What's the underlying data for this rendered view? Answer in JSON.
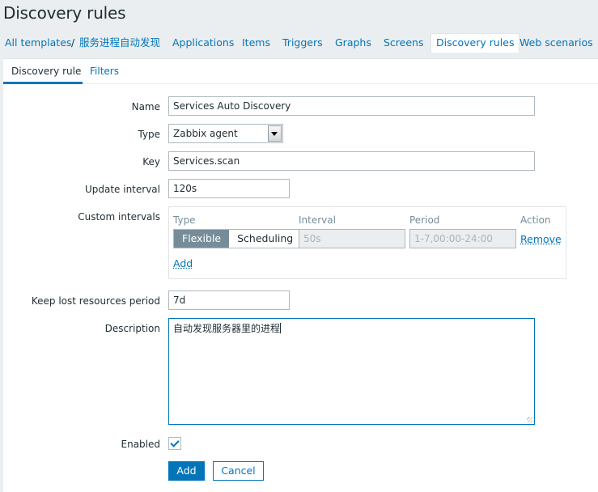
{
  "page": {
    "title": "Discovery rules"
  },
  "nav": {
    "all_templates": "All templates",
    "separator": "/",
    "template_name": "服务进程自动发现",
    "applications": "Applications",
    "items": "Items",
    "triggers": "Triggers",
    "graphs": "Graphs",
    "screens": "Screens",
    "discovery_rules": "Discovery rules",
    "web_scenarios": "Web scenarios"
  },
  "tabs": {
    "discovery_rule": "Discovery rule",
    "filters": "Filters"
  },
  "form": {
    "name": {
      "label": "Name",
      "value": "Services Auto Discovery"
    },
    "type": {
      "label": "Type",
      "value": "Zabbix agent"
    },
    "key": {
      "label": "Key",
      "value": "Services.scan"
    },
    "update_interval": {
      "label": "Update interval",
      "value": "120s"
    },
    "custom_intervals": {
      "label": "Custom intervals",
      "headers": {
        "type": "Type",
        "interval": "Interval",
        "period": "Period",
        "action": "Action"
      },
      "row": {
        "flexible": "Flexible",
        "scheduling": "Scheduling",
        "interval": "50s",
        "period": "1-7,00:00-24:00",
        "remove": "Remove"
      },
      "add": "Add"
    },
    "keep_lost": {
      "label": "Keep lost resources period",
      "value": "7d"
    },
    "description": {
      "label": "Description",
      "value": "自动发现服务器里的进程"
    },
    "enabled": {
      "label": "Enabled",
      "checked": true
    }
  },
  "buttons": {
    "add": "Add",
    "cancel": "Cancel"
  },
  "colors": {
    "accent": "#0275b8",
    "segment_active": "#768d99",
    "background": "#ebeef0"
  }
}
